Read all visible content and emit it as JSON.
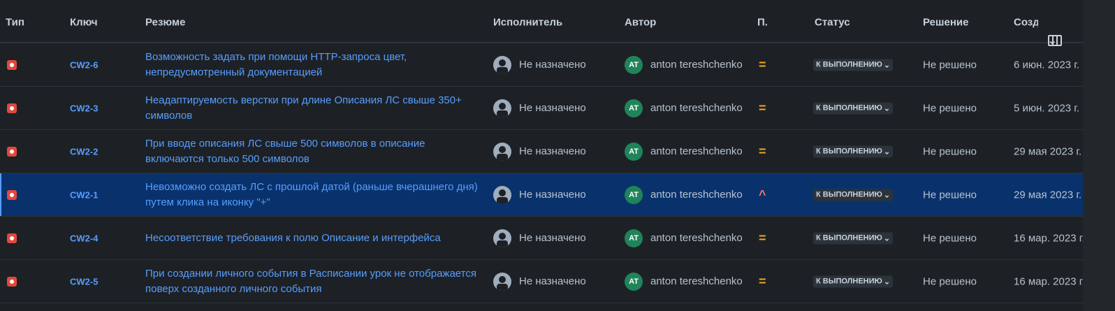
{
  "headers": {
    "type": "Тип",
    "key": "Ключ",
    "summary": "Резюме",
    "assignee": "Исполнитель",
    "author": "Автор",
    "priority": "П.",
    "status": "Статус",
    "resolution": "Решение",
    "created": "Созд"
  },
  "rows": [
    {
      "key": "CW2-6",
      "summary": "Возможность задать при помощи HTTP-запроса цвет, непредусмотренный документацией",
      "assignee": "Не назначено",
      "author_initials": "AT",
      "author": "anton tereshchenko",
      "priority": "=",
      "status": "К ВЫПОЛНЕНИЮ",
      "resolution": "Не решено",
      "created": "6 июн. 2023 г."
    },
    {
      "key": "CW2-3",
      "summary": "Неадаптируемость верстки при длине Описания ЛС свыше 350+ символов",
      "assignee": "Не назначено",
      "author_initials": "AT",
      "author": "anton tereshchenko",
      "priority": "=",
      "status": "К ВЫПОЛНЕНИЮ",
      "resolution": "Не решено",
      "created": "5 июн. 2023 г."
    },
    {
      "key": "CW2-2",
      "summary": "При вводе описания ЛС свыше 500 символов в описание включаются только 500 символов",
      "assignee": "Не назначено",
      "author_initials": "AT",
      "author": "anton tereshchenko",
      "priority": "=",
      "status": "К ВЫПОЛНЕНИЮ",
      "resolution": "Не решено",
      "created": "29 мая 2023 г."
    },
    {
      "key": "CW2-1",
      "summary": "Невозможно создать ЛС с прошлой датой (раньше вчерашнего дня) путем клика на иконку \"+\"",
      "assignee": "Не назначено",
      "author_initials": "AT",
      "author": "anton tereshchenko",
      "priority": "^",
      "status": "К ВЫПОЛНЕНИЮ",
      "resolution": "Не решено",
      "created": "29 мая 2023 г."
    },
    {
      "key": "CW2-4",
      "summary": "Несоответствие требования к полю Описание и интерфейса",
      "assignee": "Не назначено",
      "author_initials": "AT",
      "author": "anton tereshchenko",
      "priority": "=",
      "status": "К ВЫПОЛНЕНИЮ",
      "resolution": "Не решено",
      "created": "16 мар. 2023 г."
    },
    {
      "key": "CW2-5",
      "summary": "При создании личного события в Расписании урок не отображается поверх созданного личного события",
      "assignee": "Не назначено",
      "author_initials": "AT",
      "author": "anton tereshchenko",
      "priority": "=",
      "status": "К ВЫПОЛНЕНИЮ",
      "resolution": "Не решено",
      "created": "16 мар. 2023 г."
    }
  ],
  "selected_row_index": 3,
  "icons": {
    "issue_type": "bug-icon",
    "columns": "columns-icon",
    "chevron": "chevron-down-icon"
  },
  "colors": {
    "background": "#1d2125",
    "link": "#579dff",
    "selected_row": "#09326c",
    "bug": "#e2483d",
    "avatar_author": "#1f845a",
    "priority_medium": "#f5a623",
    "priority_high": "#f87168"
  }
}
